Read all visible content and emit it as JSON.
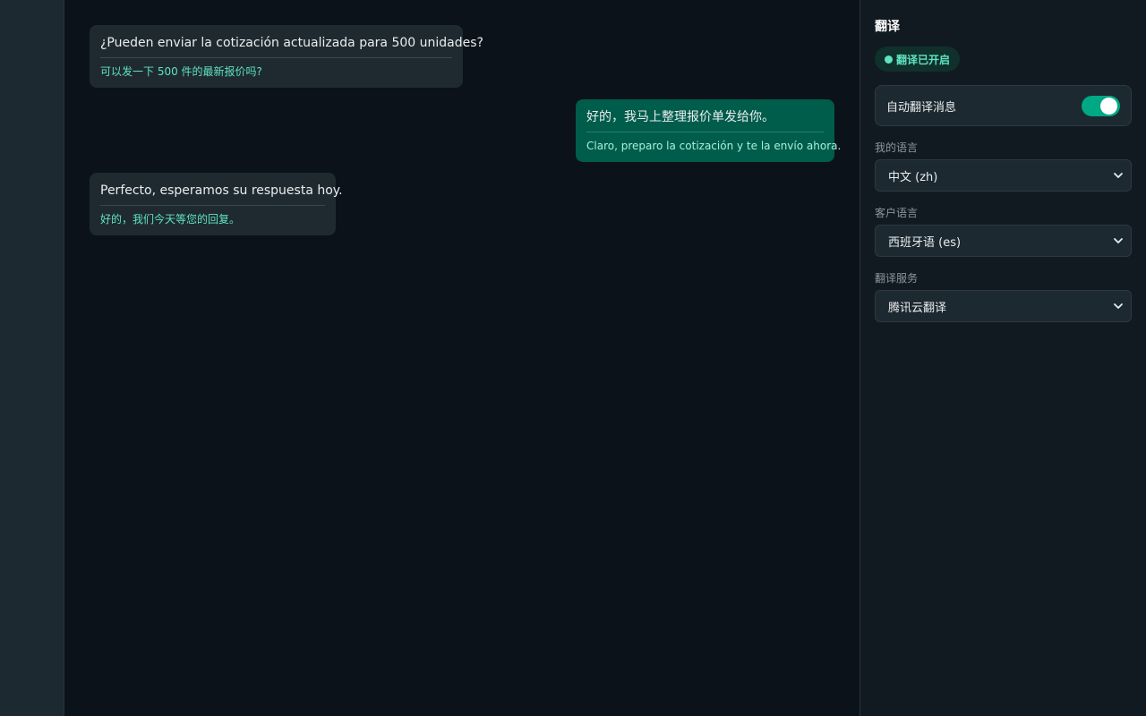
{
  "messages": [
    {
      "direction": "incoming",
      "original": "¿Pueden enviar la cotización actualizada para 500 unidades?",
      "translation": "可以发一下 500 件的最新报价吗?"
    },
    {
      "direction": "outgoing",
      "original": "好的，我马上整理报价单发给你。",
      "translation": "Claro, preparo la cotización y te la envío ahora."
    },
    {
      "direction": "incoming",
      "original": "Perfecto, esperamos su respuesta hoy.",
      "translation": "好的，我们今天等您的回复。"
    }
  ],
  "panel": {
    "title": "翻译",
    "status": "翻译已开启",
    "auto_translate_label": "自动翻译消息",
    "auto_translate_on": true,
    "my_language_label": "我的语言",
    "my_language_value": "中文 (zh)",
    "customer_language_label": "客户语言",
    "customer_language_value": "西班牙语 (es)",
    "service_label": "翻译服务",
    "service_value": "腾讯云翻译"
  },
  "colors": {
    "accent": "#00a884",
    "status_text": "#5fe3c0",
    "outgoing_bubble": "#005c4b",
    "incoming_bubble": "#1f2a30"
  },
  "icons": {
    "select_chevron": "chevron-down-icon",
    "status_indicator": "status-dot-icon"
  }
}
